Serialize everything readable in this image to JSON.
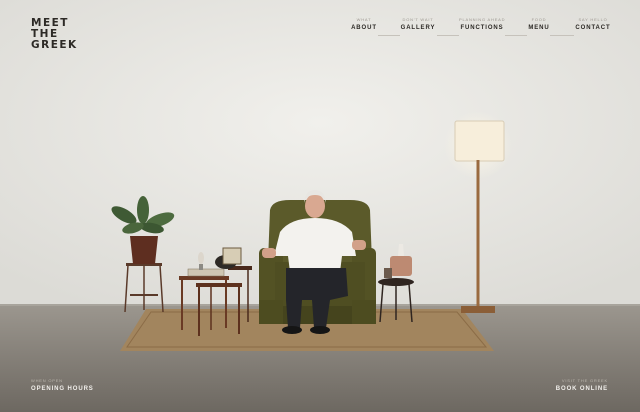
{
  "brand": {
    "logo_lines": [
      "MEET",
      "THE",
      "GREEK"
    ]
  },
  "nav": {
    "items": [
      {
        "sub": "WHAT",
        "label": "ABOUT"
      },
      {
        "sub": "DON'T WAIT",
        "label": "GALLERY"
      },
      {
        "sub": "PLANNING AHEAD",
        "label": "FUNCTIONS"
      },
      {
        "sub": "FOOD",
        "label": "MENU"
      },
      {
        "sub": "SAY HELLO",
        "label": "CONTACT"
      }
    ]
  },
  "footer": {
    "left": {
      "sub": "WHEN OPEN",
      "label": "OPENING HOURS"
    },
    "right": {
      "sub": "VISIT THE GREEK",
      "label": "BOOK ONLINE"
    }
  },
  "colors": {
    "wall": "#e9e8e4",
    "floor": "#8a857d",
    "armchair": "#5b5a2a",
    "rug": "#a2855e"
  }
}
